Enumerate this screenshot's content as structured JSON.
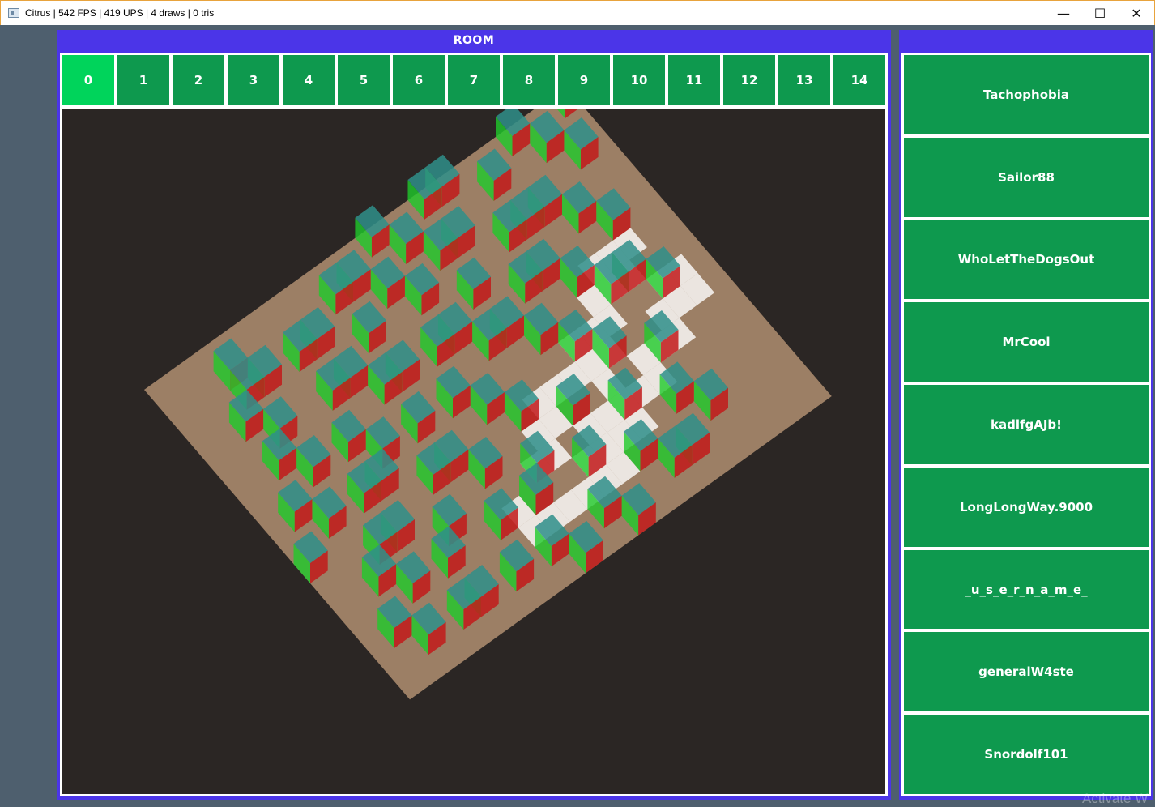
{
  "window": {
    "title": "Citrus | 542 FPS | 419 UPS | 4 draws | 0 tris",
    "minimize_glyph": "—",
    "maximize_glyph": "☐",
    "close_glyph": "✕",
    "icon": "app-window-icon"
  },
  "room": {
    "header": "ROOM",
    "selected_index": 0,
    "tabs": [
      "0",
      "1",
      "2",
      "3",
      "4",
      "5",
      "6",
      "7",
      "8",
      "9",
      "10",
      "11",
      "12",
      "13",
      "14"
    ]
  },
  "players": {
    "header": "",
    "items": [
      "Tachophobia",
      "Sailor88",
      "WhoLetTheDogsOut",
      "MrCool",
      "kadlfgAJb!",
      "LongLongWay.9000",
      "_u_s_e_r_n_a_m_e_",
      "generalW4ste",
      "Snordolf101"
    ]
  },
  "watermark": "Activate W",
  "colors": {
    "accent": "#4b35e8",
    "tab": "#0e994e",
    "tab_active": "#00d45b",
    "viewport_bg": "#2b2624",
    "floor": "#9c7f65",
    "block_top": "#2f8f8a",
    "block_left": "#1fcb2a",
    "block_right": "#c21a1a",
    "highlight": "#ffffff"
  }
}
